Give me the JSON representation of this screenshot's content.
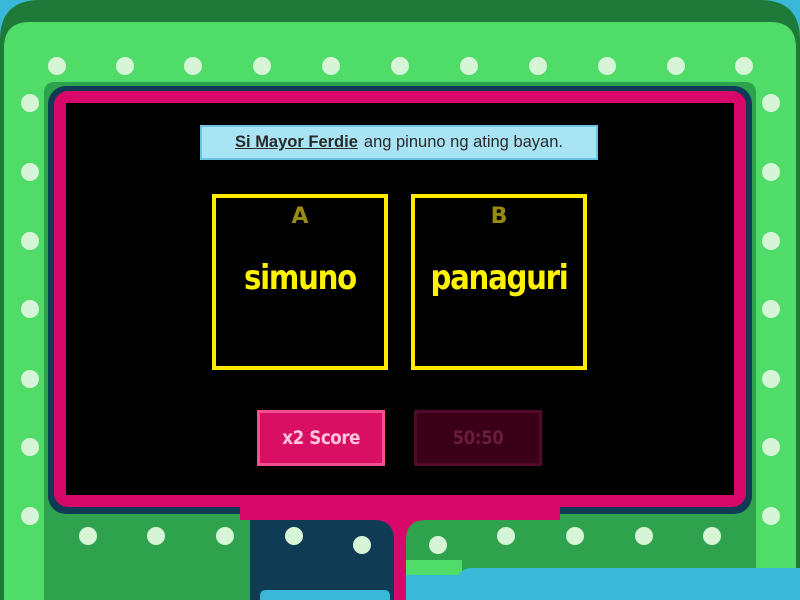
{
  "theme": {
    "background": "#3ab8d8",
    "outer_frame": "#1f7a3a",
    "light_band": "#4fdc68",
    "screen_frame": "#d8086a",
    "screen": "#000000",
    "bulb": "#d6f5d6",
    "answer_border": "#ffea00",
    "answer_text": "#fff200"
  },
  "question": {
    "subject": "Si Mayor Ferdie",
    "rest": "ang pinuno ng ating bayan."
  },
  "answers": [
    {
      "letter": "A",
      "text": "simuno"
    },
    {
      "letter": "B",
      "text": "panaguri"
    }
  ],
  "powerups": {
    "double_score": {
      "label": "x2 Score",
      "enabled": true
    },
    "fifty_fifty": {
      "label": "50:50",
      "enabled": false
    }
  }
}
